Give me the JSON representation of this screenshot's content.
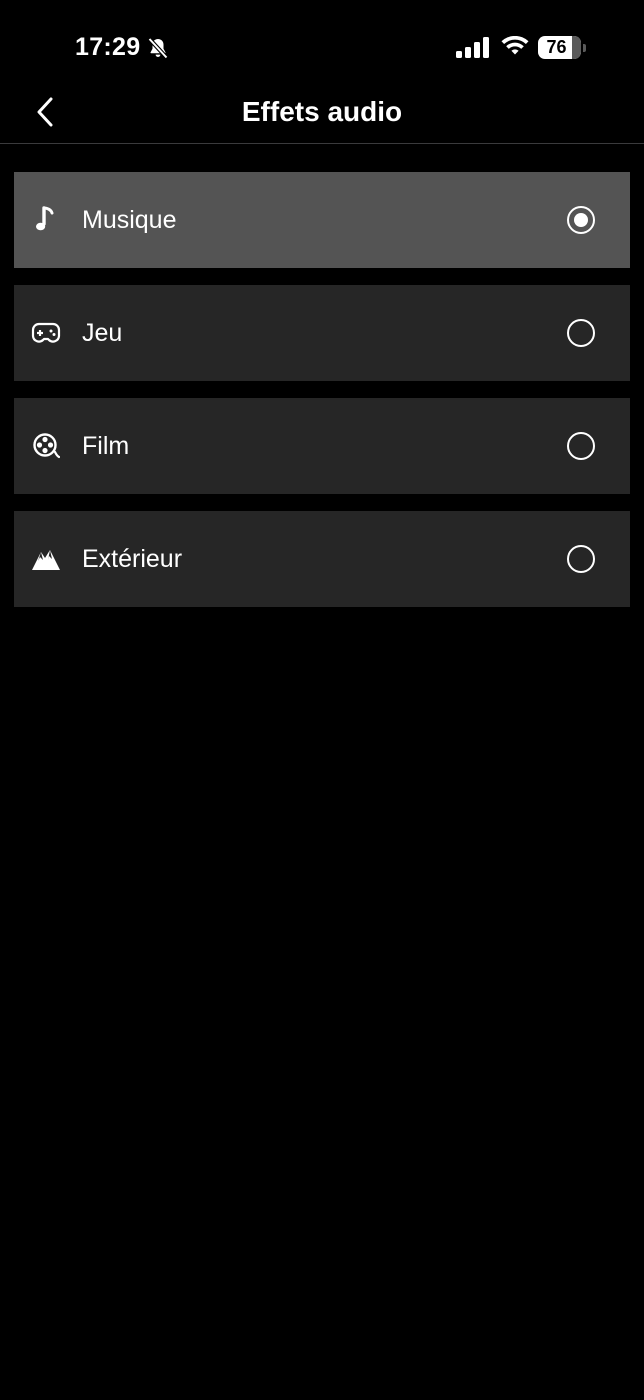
{
  "status_bar": {
    "time": "17:29",
    "battery": "76",
    "icons": [
      "bell-slash-icon",
      "signal-icon",
      "wifi-icon",
      "battery-icon"
    ]
  },
  "nav": {
    "title": "Effets audio",
    "back_icon": "chevron-left-icon"
  },
  "options": [
    {
      "label": "Musique",
      "icon": "music-note-icon",
      "selected": true
    },
    {
      "label": "Jeu",
      "icon": "gamepad-icon",
      "selected": false
    },
    {
      "label": "Film",
      "icon": "film-reel-icon",
      "selected": false
    },
    {
      "label": "Extérieur",
      "icon": "mountain-icon",
      "selected": false
    }
  ],
  "colors": {
    "background": "#000000",
    "item_background": "#262626",
    "item_selected_background": "#545454",
    "text": "#ffffff",
    "divider": "#3a3a3c"
  }
}
